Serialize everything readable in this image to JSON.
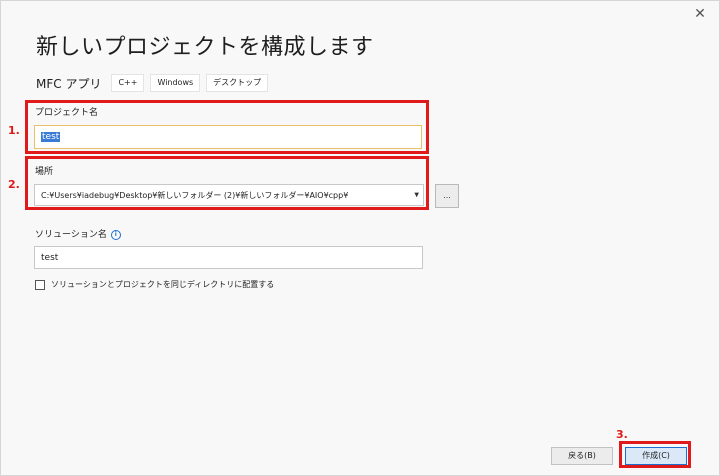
{
  "dialog": {
    "title": "新しいプロジェクトを構成します",
    "close_glyph": "✕"
  },
  "template": {
    "name": "MFC アプリ",
    "tags": [
      "C++",
      "Windows",
      "デスクトップ"
    ]
  },
  "project_name": {
    "label": "プロジェクト名",
    "value": "test"
  },
  "location": {
    "label": "場所",
    "value": "C:¥Users¥iadebug¥Desktop¥新しいフォルダー (2)¥新しいフォルダー¥AIO¥cpp¥",
    "browse_label": "..."
  },
  "solution_name": {
    "label": "ソリューション名",
    "info_icon": "info-icon",
    "value": "test"
  },
  "same_dir_checkbox": {
    "label": "ソリューションとプロジェクトを同じディレクトリに配置する",
    "checked": false
  },
  "footer": {
    "back_label": "戻る(B)",
    "create_label": "作成(C)"
  },
  "annotations": {
    "step1": "1.",
    "step2": "2.",
    "step3": "3.",
    "color": "#e01a1a"
  }
}
